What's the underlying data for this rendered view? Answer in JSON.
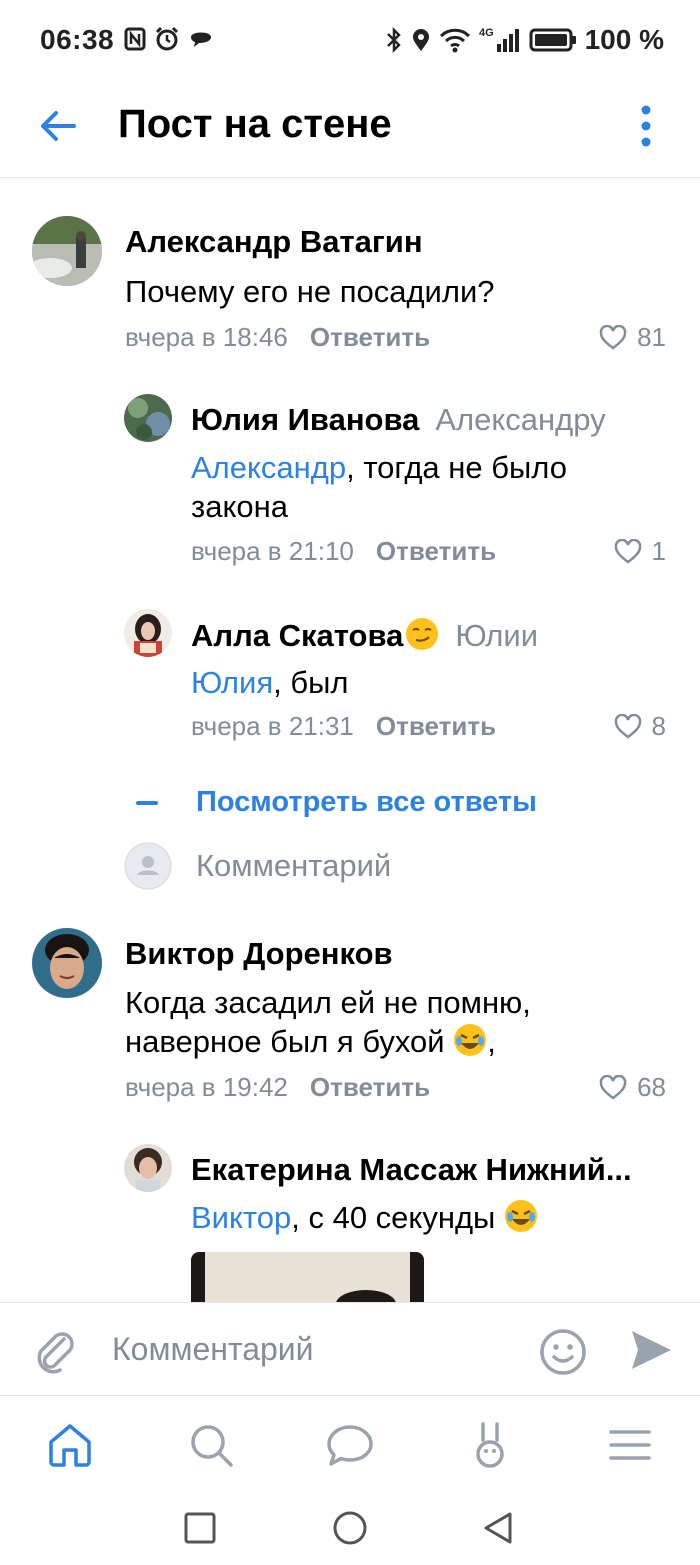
{
  "status_bar": {
    "time": "06:38",
    "network": "4G",
    "battery": "100 %"
  },
  "header": {
    "title": "Пост на стене"
  },
  "comments": [
    {
      "author": "Александр Ватагин",
      "text": "Почему его не посадили?",
      "time": "вчера в 18:46",
      "reply_label": "Ответить",
      "likes": "81"
    },
    {
      "author": "Юлия Иванова",
      "reply_to": "Александру",
      "mention": "Александр",
      "text": ", тогда не было закона",
      "time": "вчера в 21:10",
      "reply_label": "Ответить",
      "likes": "1"
    },
    {
      "author": "Алла Скатова",
      "reply_to": "Юлии",
      "mention": "Юлия",
      "text": ", был",
      "time": "вчера в 21:31",
      "reply_label": "Ответить",
      "likes": "8"
    },
    {
      "author": "Виктор Доренков",
      "text_line1": "Когда засадил ей не помню,",
      "text_line2": "наверное был я бухой ",
      "text_suffix": ",",
      "time": "вчера в 19:42",
      "reply_label": "Ответить",
      "likes": "68"
    },
    {
      "author": "Екатерина Массаж Нижний...",
      "mention": "Виктор",
      "text": ", с 40 секунды "
    }
  ],
  "thread": {
    "show_all_label": "Посмотреть все ответы",
    "comment_placeholder": "Комментарий"
  },
  "composer": {
    "placeholder": "Комментарий"
  },
  "colors": {
    "accent": "#2d81e0",
    "secondary_text": "#818c99",
    "divider": "#e7e8ec"
  }
}
